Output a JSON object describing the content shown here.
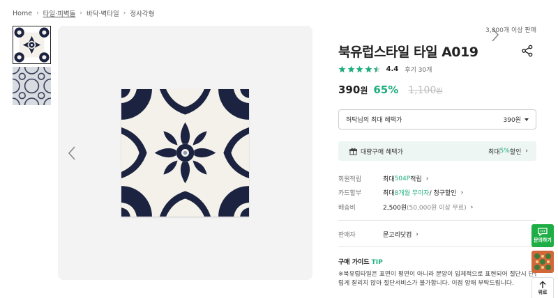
{
  "breadcrumb": {
    "items": [
      "Home",
      "타일·피벽돌",
      "바닥·벽타일",
      "정사각형"
    ]
  },
  "product": {
    "sold_text": "3,800개 이상 판매",
    "title": "북유럽스타일 타일 A019",
    "rating": 4.4,
    "rating_text": "4.4",
    "review_text": "후기 30개",
    "price": "390",
    "price_unit": "원",
    "discount": "65%",
    "original_price": "1,100",
    "original_unit": "원"
  },
  "benefit": {
    "label": "허탁님의 최대 혜택가",
    "value": "390원"
  },
  "bulk": {
    "label": "대량구매 혜택가",
    "prefix": "최대 ",
    "percent": "5%",
    "suffix": " 할인"
  },
  "info": {
    "points_key": "회원적립",
    "points_prefix": "최대 ",
    "points_value": "504P",
    "points_suffix": " 적립",
    "card_key": "카드할부",
    "card_prefix": "최대 ",
    "card_value": "8개월 무이자",
    "card_suffix": " / 청구할인",
    "shipping_key": "배송비",
    "shipping_value": "2,500원",
    "shipping_note": " (50,000원 이상 무료)",
    "seller_key": "판매자",
    "seller_value": "문고리닷컴"
  },
  "guide": {
    "title_prefix": "구매 가이드 ",
    "title_tip": "TIP",
    "text_line1": "※북유럽타일은 표면이 평면이 아니라 문양이 입체적으로 표현되어 절단시 단면이 매끄",
    "text_line2": "럽게 잘리지 않아 절단서비스가 불가합니다. 이점 양해 부탁드립니다."
  },
  "floating": {
    "inquiry_label": "문의하기",
    "top_label": "위로"
  },
  "colors": {
    "accent": "#1fae7e",
    "inquiry": "#1fae46",
    "tile_navy": "#1b2340",
    "tile_cream": "#f4f1ea"
  }
}
